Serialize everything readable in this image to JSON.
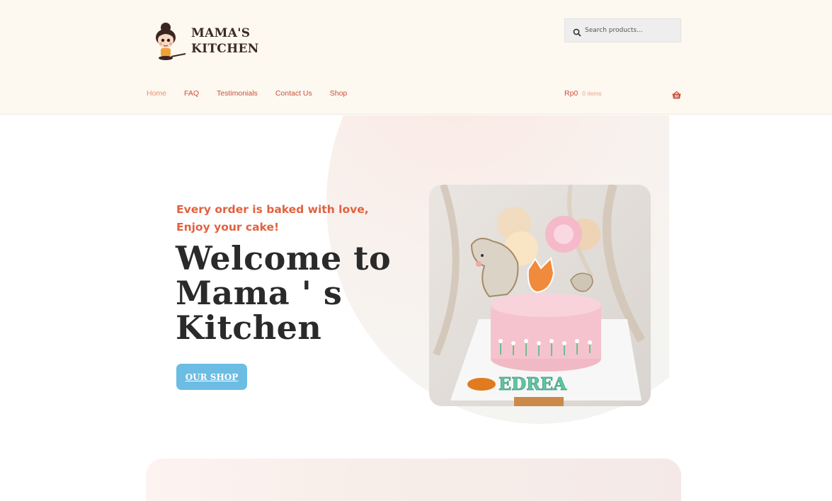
{
  "brand": {
    "name_line1": "MAMA'S",
    "name_line2": "KITCHEN"
  },
  "search": {
    "placeholder": "Search products..."
  },
  "nav": {
    "items": [
      {
        "label": "Home"
      },
      {
        "label": "FAQ"
      },
      {
        "label": "Testimonials"
      },
      {
        "label": "Contact Us"
      },
      {
        "label": "Shop"
      }
    ]
  },
  "cart": {
    "amount": "Rp0",
    "count": "0 items",
    "icon": "basket-icon"
  },
  "hero": {
    "tagline": "Every order is baked with love, Enjoy your cake!",
    "title": "Welcome to Mama ' s Kitchen",
    "button_label": "OUR SHOP",
    "image_text": "EDREA"
  },
  "colors": {
    "accent": "#c8513b",
    "tagline": "#e2613f",
    "button": "#6cbde3",
    "header_bg": "#fdf8f0"
  }
}
